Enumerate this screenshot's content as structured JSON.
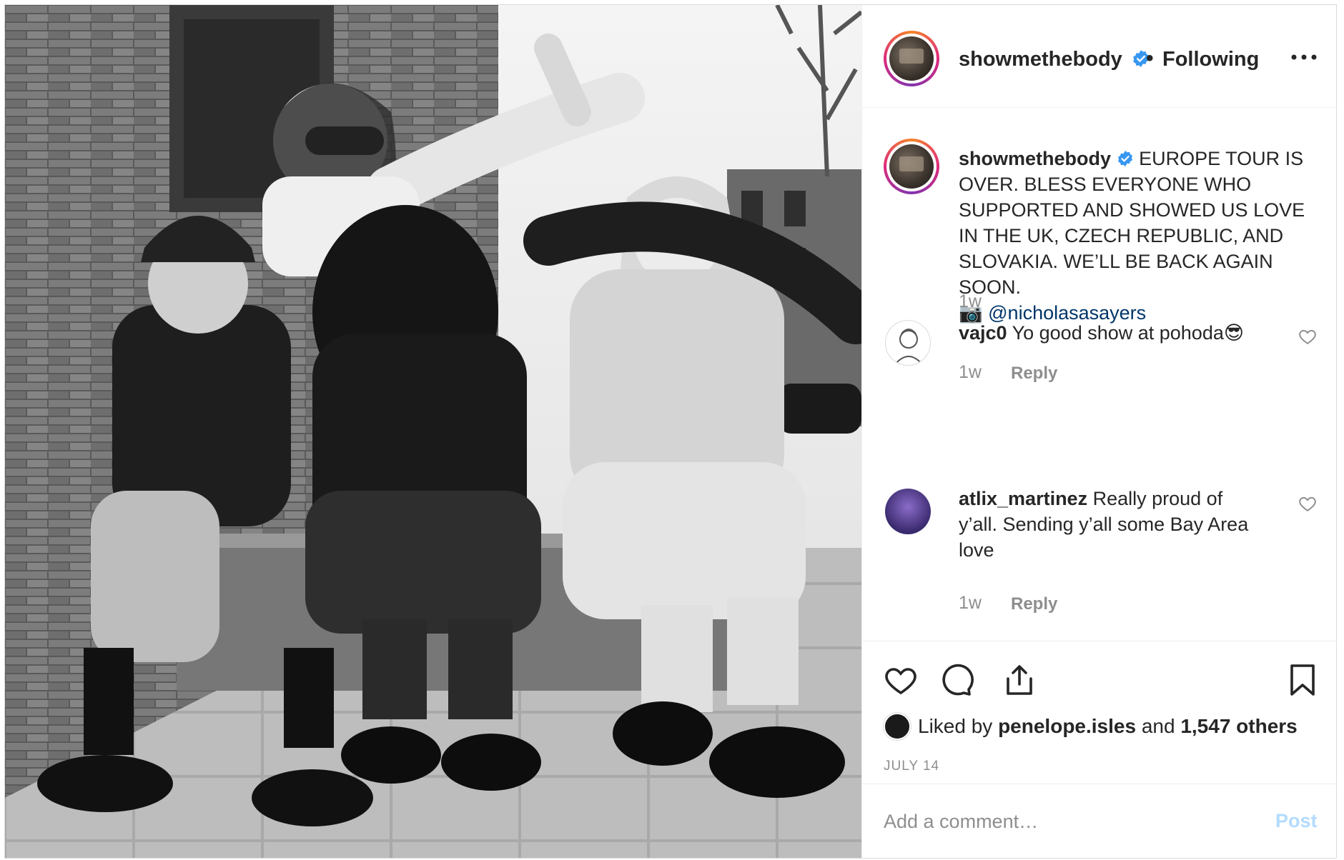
{
  "post": {
    "author": {
      "username": "showmethebody",
      "verified": true,
      "follow_status": "Following",
      "separator": "•"
    },
    "more_options_label": "•••",
    "photo": {
      "description_icon": "photo-icon",
      "style": "black-and-white"
    },
    "caption": {
      "username": "showmethebody",
      "text_lines": [
        "EUROPE TOUR IS",
        "OVER. BLESS EVERYONE WHO",
        "SUPPORTED AND SHOWED US LOVE",
        "IN THE UK, CZECH REPUBLIC, AND",
        "SLOVAKIA. WE’LL BE BACK AGAIN",
        "SOON."
      ],
      "camera_emoji": "📷",
      "mention": "@nicholasasayers",
      "age": "1w"
    },
    "comments": [
      {
        "username": "vajc0",
        "text": "Yo good show at pohoda",
        "emoji": "😎",
        "age": "1w",
        "reply_label": "Reply"
      },
      {
        "username": "atlix_martinez",
        "text_lines": [
          "Really proud of",
          "y’all. Sending y’all some Bay Area",
          "love"
        ],
        "age": "1w",
        "reply_label": "Reply"
      }
    ],
    "likes": {
      "prefix": "Liked by",
      "liker": "penelope.isles",
      "conjunction": "and",
      "others": "1,547 others"
    },
    "date": "JULY 14",
    "add_comment": {
      "placeholder": "Add a comment…",
      "post_label": "Post"
    }
  },
  "colors": {
    "verified_badge": "#3897f0",
    "mention": "#003569",
    "muted_text": "#8e8e8e",
    "post_button_disabled": "#b3dbff",
    "border": "#dbdbdb"
  },
  "icons": [
    "heart-icon",
    "comment-icon",
    "share-icon",
    "bookmark-icon",
    "verified-badge-icon",
    "more-icon"
  ]
}
